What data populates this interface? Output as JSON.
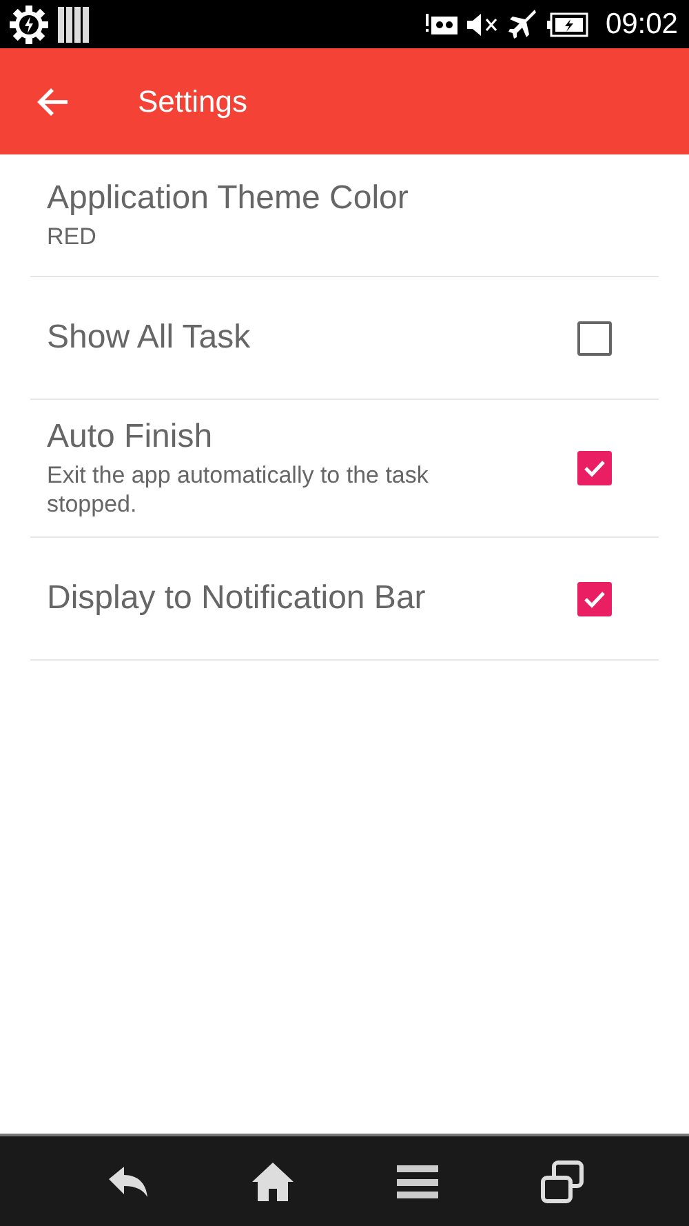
{
  "status_bar": {
    "time": "09:02"
  },
  "app_bar": {
    "title": "Settings"
  },
  "settings": [
    {
      "kind": "value",
      "title": "Application Theme Color",
      "value": "RED"
    },
    {
      "kind": "checkbox",
      "title": "Show All Task",
      "checked": false
    },
    {
      "kind": "checkbox",
      "title": "Auto Finish",
      "summary": "Exit the app automatically to the task stopped.",
      "checked": true
    },
    {
      "kind": "checkbox",
      "title": "Display to Notification Bar",
      "checked": true
    }
  ]
}
